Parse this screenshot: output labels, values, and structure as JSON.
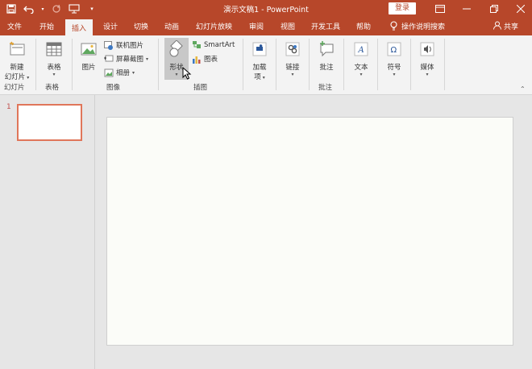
{
  "titlebar": {
    "doc_title": "演示文稿1  -  PowerPoint",
    "login_label": "登录"
  },
  "tabs": [
    {
      "label": "文件"
    },
    {
      "label": "开始"
    },
    {
      "label": "插入"
    },
    {
      "label": "设计"
    },
    {
      "label": "切换"
    },
    {
      "label": "动画"
    },
    {
      "label": "幻灯片放映"
    },
    {
      "label": "审阅"
    },
    {
      "label": "视图"
    },
    {
      "label": "开发工具"
    },
    {
      "label": "帮助"
    }
  ],
  "tell_me": "操作说明搜索",
  "share_label": "共享",
  "ribbon": {
    "new_slide": "新建\n幻灯片",
    "new_slide_l1": "新建",
    "new_slide_l2": "幻灯片",
    "group_slides": "幻灯片",
    "table": "表格",
    "group_tables": "表格",
    "picture": "图片",
    "online_pictures": "联机图片",
    "screenshot": "屏幕截图",
    "album": "相册",
    "group_images": "图像",
    "shapes": "形状",
    "smartart": "SmartArt",
    "chart": "图表",
    "group_illustrations": "插图",
    "addins_l1": "加载",
    "addins_l2": "项",
    "link": "链接",
    "comment": "批注",
    "group_comments": "批注",
    "text": "文本",
    "symbols": "符号",
    "media": "媒体"
  },
  "slides_panel": {
    "slide_number": "1"
  },
  "colors": {
    "accent": "#b7472a",
    "thumb_border": "#e0765a"
  }
}
